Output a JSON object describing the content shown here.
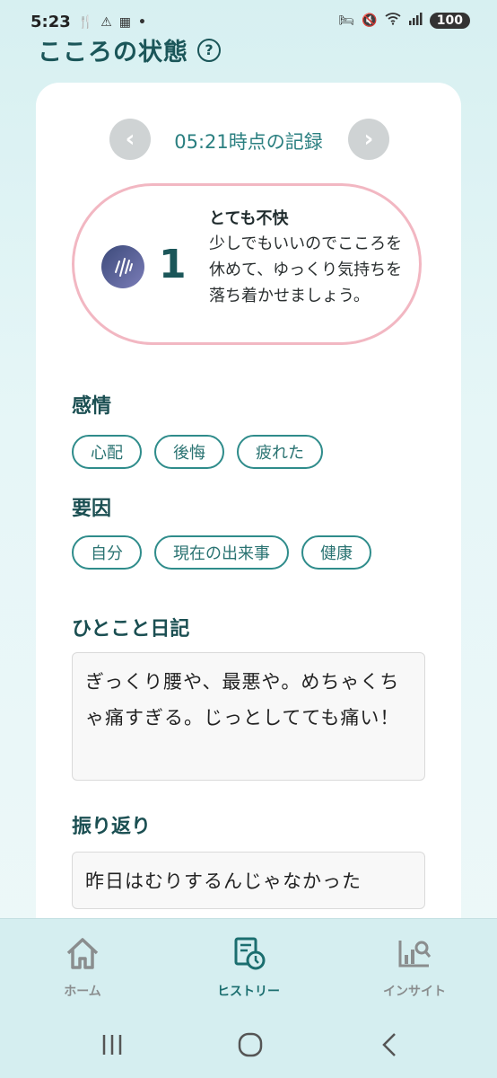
{
  "status_bar": {
    "time": "5:23",
    "battery": "100"
  },
  "header": {
    "title": "こころの状態",
    "help_glyph": "?"
  },
  "record": {
    "label": "05:21時点の記録",
    "prev_glyph": "‹",
    "next_glyph": "›"
  },
  "mood": {
    "score": "1",
    "title": "とても不快",
    "description": "少しでもいいのでこころを休めて、ゆっくり気持ちを落ち着かせましょう。"
  },
  "emotions": {
    "heading": "感情",
    "chips": [
      "心配",
      "後悔",
      "疲れた"
    ]
  },
  "factors": {
    "heading": "要因",
    "chips": [
      "自分",
      "現在の出来事",
      "健康"
    ]
  },
  "diary": {
    "heading": "ひとこと日記",
    "text": "ぎっくり腰や、最悪や。めちゃくちゃ痛すぎる。じっとしてても痛い！"
  },
  "reflection": {
    "heading": "振り返り",
    "text": "昨日はむりするんじゃなかった"
  },
  "bottom_nav": {
    "home": "ホーム",
    "history": "ヒストリー",
    "insight": "インサイト"
  },
  "colors": {
    "accent": "#1b5659",
    "chip_border": "#2f8c8b",
    "mood_border": "#f2b7c2",
    "active_nav": "#1b6e6f"
  }
}
